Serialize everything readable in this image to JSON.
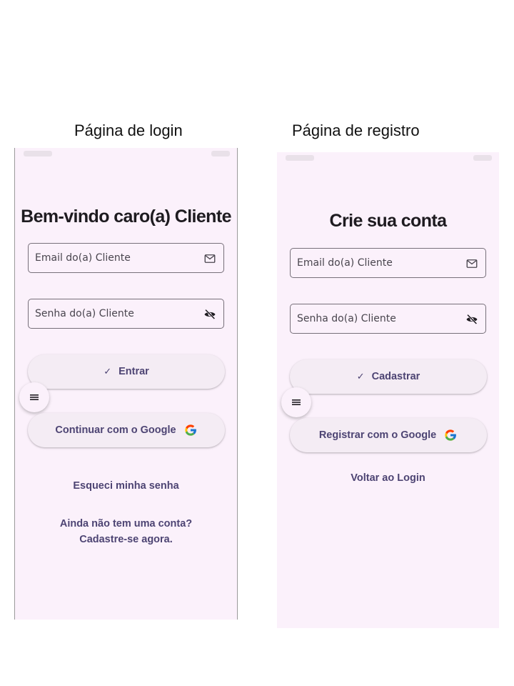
{
  "captions": {
    "login": "Página de login",
    "register": "Página de registro"
  },
  "login_page": {
    "title": "Bem-vindo caro(a) Cliente",
    "email_placeholder": "Email do(a) Cliente",
    "email_icon": "mail-icon",
    "password_placeholder": "Senha do(a) Cliente",
    "password_icon": "visibility-off-icon",
    "submit_label": "Entrar",
    "submit_icon": "check-icon",
    "menu_icon": "menu-icon",
    "google_label": "Continuar com o Google",
    "google_icon": "google-icon",
    "forgot_password": "Esqueci minha senha",
    "signup_line1": "Ainda não tem uma conta?",
    "signup_line2": "Cadastre-se agora."
  },
  "register_page": {
    "title": "Crie sua conta",
    "email_placeholder": "Email do(a) Cliente",
    "email_icon": "mail-icon",
    "password_placeholder": "Senha do(a) Cliente",
    "password_icon": "visibility-off-icon",
    "submit_label": "Cadastrar",
    "submit_icon": "check-icon",
    "menu_icon": "menu-icon",
    "google_label": "Registrar com o Google",
    "google_icon": "google-icon",
    "back_to_login": "Voltar ao Login"
  },
  "colors": {
    "background": "#fbf1fb",
    "button_bg": "#f4ecf4",
    "accent_text": "#4d4473",
    "outline": "#77707a"
  }
}
